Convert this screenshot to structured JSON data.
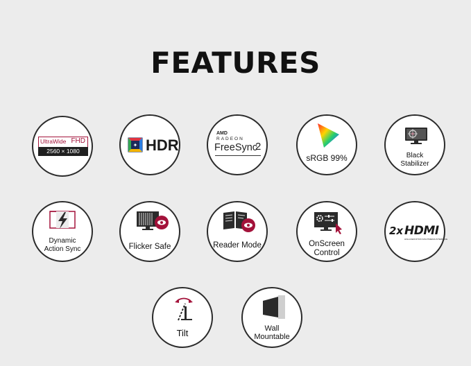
{
  "title": "FEATURES",
  "features": [
    {
      "id": "ultrawide",
      "line1": "UltraWide FHD",
      "line1a": "UltraWide",
      "line1b": "FHD",
      "line2": "2560 × 1080"
    },
    {
      "id": "hdr",
      "label": "HDR"
    },
    {
      "id": "freesync",
      "brand": "AMD",
      "sub": "RADEON",
      "label": "FreeSync",
      "suffix": "2"
    },
    {
      "id": "srgb",
      "label": "sRGB 99%"
    },
    {
      "id": "black",
      "label1": "Black",
      "label2": "Stabilizer"
    },
    {
      "id": "das",
      "label1": "Dynamic",
      "label2": "Action Sync"
    },
    {
      "id": "flicker",
      "label": "Flicker Safe"
    },
    {
      "id": "reader",
      "label": "Reader Mode"
    },
    {
      "id": "onscreen",
      "label1": "OnScreen",
      "label2": "Control"
    },
    {
      "id": "hdmi",
      "prefix": "2x",
      "label": "HDMI",
      "tagline": "HIGH-DEFINITION MULTIMEDIA INTERFACE"
    },
    {
      "id": "tilt",
      "label": "Tilt"
    },
    {
      "id": "wall",
      "label1": "Wall",
      "label2": "Mountable"
    }
  ],
  "colors": {
    "accent": "#a3123a",
    "dark": "#2b2b2b",
    "background": "#ececec"
  }
}
